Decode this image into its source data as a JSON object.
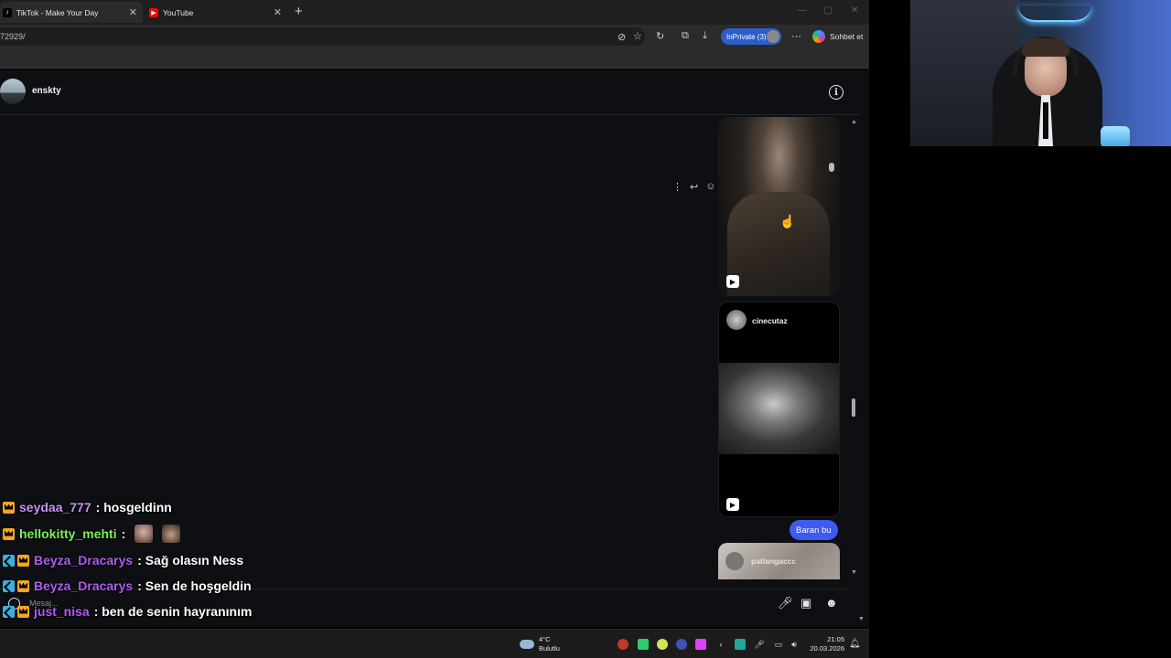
{
  "browser": {
    "tabs": [
      {
        "title": "TikTok - Make Your Day",
        "favicon": "tiktok-icon"
      },
      {
        "title": "YouTube",
        "favicon": "youtube-icon"
      }
    ],
    "url_fragment": "72929/",
    "inprivate_label": "InPrivate (3)",
    "copilot_label": "Sohbet et"
  },
  "dm": {
    "username": "enskty",
    "shared_reel_account": "cinecutaz",
    "sent_message": "Baran bu",
    "partial_account": "patlangaccc",
    "composer_placeholder": "Mesaj..."
  },
  "chat_overlay": [
    {
      "badges": [
        "crown"
      ],
      "username": "seydaa_777",
      "name_color": "#c894f0",
      "message": ": hosgeldinn",
      "emotes": 0
    },
    {
      "badges": [
        "crown"
      ],
      "username": "hellokitty_mehti",
      "name_color": "#7cf05a",
      "message": ":",
      "emotes": 2
    },
    {
      "badges": [
        "sword",
        "crown"
      ],
      "username": "Beyza_Dracarys",
      "name_color": "#b05cf0",
      "message": ": Sağ olasın Ness",
      "emotes": 0
    },
    {
      "badges": [
        "sword",
        "crown"
      ],
      "username": "Beyza_Dracarys",
      "name_color": "#b05cf0",
      "message": ": Sen de hoşgeldin",
      "emotes": 0
    },
    {
      "badges": [
        "sword",
        "crown"
      ],
      "username": "just_nisa",
      "name_color": "#b05cf0",
      "message": ": ben de senin hayranınım",
      "emotes": 0
    }
  ],
  "taskbar": {
    "temperature": "4°C",
    "weather": "Bulutlu",
    "time": "21:05",
    "date": "20.03.2026"
  },
  "colors": {
    "accent_blue": "#3d5af1",
    "inprivate_blue": "#2b5ec9",
    "page_bg": "#0d0f12"
  }
}
